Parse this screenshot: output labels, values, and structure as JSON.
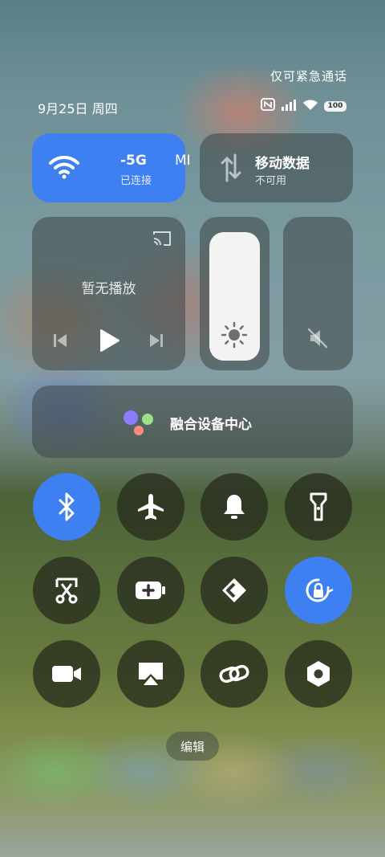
{
  "status": {
    "emergency_text": "仅可紧急通话",
    "date": "9月25日 周四",
    "battery": "100"
  },
  "wifi_tile": {
    "ssid": "-5G",
    "ssid_extra": "MIC",
    "status": "已连接"
  },
  "mobile_data_tile": {
    "title": "移动数据",
    "status": "不可用"
  },
  "media": {
    "status": "暂无播放"
  },
  "brightness": {
    "level": 0.9
  },
  "volume": {
    "level": 0.0
  },
  "device_center": {
    "label": "融合设备中心"
  },
  "quick_toggles": [
    {
      "name": "bluetooth",
      "active": true
    },
    {
      "name": "airplane-mode",
      "active": false
    },
    {
      "name": "ringer",
      "active": false
    },
    {
      "name": "flashlight",
      "active": false
    },
    {
      "name": "screenshot",
      "active": false
    },
    {
      "name": "battery-saver",
      "active": false
    },
    {
      "name": "kdeconnect",
      "active": false
    },
    {
      "name": "rotation-lock",
      "active": true
    },
    {
      "name": "screen-recorder",
      "active": false
    },
    {
      "name": "screen-cast",
      "active": false
    },
    {
      "name": "link-share",
      "active": false
    },
    {
      "name": "settings-hex",
      "active": false
    }
  ],
  "edit_button": {
    "label": "编辑"
  },
  "colors": {
    "accent_blue": "#3e7ff2",
    "tile_dark": "rgba(60,70,70,0.55)"
  }
}
